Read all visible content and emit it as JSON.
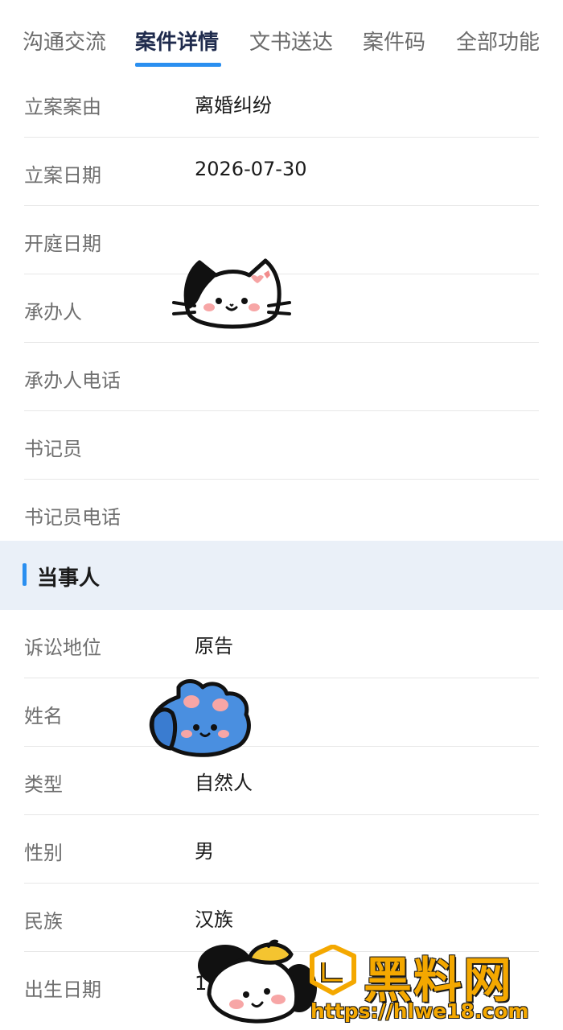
{
  "tabs": [
    {
      "label": "沟通交流",
      "active": false
    },
    {
      "label": "案件详情",
      "active": true
    },
    {
      "label": "文书送达",
      "active": false
    },
    {
      "label": "案件码",
      "active": false
    },
    {
      "label": "全部功能",
      "active": false
    }
  ],
  "case_details": [
    {
      "label": "立案案由",
      "value": "离婚纠纷"
    },
    {
      "label": "立案日期",
      "value": "2026-07-30"
    },
    {
      "label": "开庭日期",
      "value": ""
    },
    {
      "label": "承办人",
      "value": ""
    },
    {
      "label": "承办人电话",
      "value": ""
    },
    {
      "label": "书记员",
      "value": ""
    },
    {
      "label": "书记员电话",
      "value": ""
    }
  ],
  "party_section": {
    "title": "当事人"
  },
  "party_details": [
    {
      "label": "诉讼地位",
      "value": "原告"
    },
    {
      "label": "姓名",
      "value": ""
    },
    {
      "label": "类型",
      "value": "自然人"
    },
    {
      "label": "性别",
      "value": "男"
    },
    {
      "label": "民族",
      "value": "汉族"
    },
    {
      "label": "出生日期",
      "value": "19"
    }
  ],
  "watermark": {
    "name": "黑料网",
    "url": "https://hlwe18.com"
  },
  "colors": {
    "accent": "#2a8ff0",
    "section_bg": "#eaf0f8",
    "watermark": "#f4a800"
  }
}
